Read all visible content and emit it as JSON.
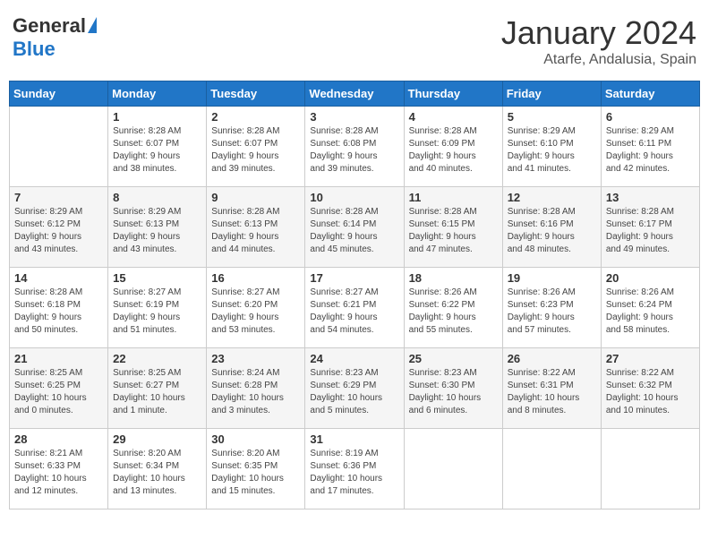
{
  "header": {
    "logo_general": "General",
    "logo_blue": "Blue",
    "month_year": "January 2024",
    "location": "Atarfe, Andalusia, Spain"
  },
  "days_of_week": [
    "Sunday",
    "Monday",
    "Tuesday",
    "Wednesday",
    "Thursday",
    "Friday",
    "Saturday"
  ],
  "weeks": [
    {
      "shaded": false,
      "days": [
        {
          "num": "",
          "info": ""
        },
        {
          "num": "1",
          "info": "Sunrise: 8:28 AM\nSunset: 6:07 PM\nDaylight: 9 hours\nand 38 minutes."
        },
        {
          "num": "2",
          "info": "Sunrise: 8:28 AM\nSunset: 6:07 PM\nDaylight: 9 hours\nand 39 minutes."
        },
        {
          "num": "3",
          "info": "Sunrise: 8:28 AM\nSunset: 6:08 PM\nDaylight: 9 hours\nand 39 minutes."
        },
        {
          "num": "4",
          "info": "Sunrise: 8:28 AM\nSunset: 6:09 PM\nDaylight: 9 hours\nand 40 minutes."
        },
        {
          "num": "5",
          "info": "Sunrise: 8:29 AM\nSunset: 6:10 PM\nDaylight: 9 hours\nand 41 minutes."
        },
        {
          "num": "6",
          "info": "Sunrise: 8:29 AM\nSunset: 6:11 PM\nDaylight: 9 hours\nand 42 minutes."
        }
      ]
    },
    {
      "shaded": true,
      "days": [
        {
          "num": "7",
          "info": "Sunrise: 8:29 AM\nSunset: 6:12 PM\nDaylight: 9 hours\nand 43 minutes."
        },
        {
          "num": "8",
          "info": "Sunrise: 8:29 AM\nSunset: 6:13 PM\nDaylight: 9 hours\nand 43 minutes."
        },
        {
          "num": "9",
          "info": "Sunrise: 8:28 AM\nSunset: 6:13 PM\nDaylight: 9 hours\nand 44 minutes."
        },
        {
          "num": "10",
          "info": "Sunrise: 8:28 AM\nSunset: 6:14 PM\nDaylight: 9 hours\nand 45 minutes."
        },
        {
          "num": "11",
          "info": "Sunrise: 8:28 AM\nSunset: 6:15 PM\nDaylight: 9 hours\nand 47 minutes."
        },
        {
          "num": "12",
          "info": "Sunrise: 8:28 AM\nSunset: 6:16 PM\nDaylight: 9 hours\nand 48 minutes."
        },
        {
          "num": "13",
          "info": "Sunrise: 8:28 AM\nSunset: 6:17 PM\nDaylight: 9 hours\nand 49 minutes."
        }
      ]
    },
    {
      "shaded": false,
      "days": [
        {
          "num": "14",
          "info": "Sunrise: 8:28 AM\nSunset: 6:18 PM\nDaylight: 9 hours\nand 50 minutes."
        },
        {
          "num": "15",
          "info": "Sunrise: 8:27 AM\nSunset: 6:19 PM\nDaylight: 9 hours\nand 51 minutes."
        },
        {
          "num": "16",
          "info": "Sunrise: 8:27 AM\nSunset: 6:20 PM\nDaylight: 9 hours\nand 53 minutes."
        },
        {
          "num": "17",
          "info": "Sunrise: 8:27 AM\nSunset: 6:21 PM\nDaylight: 9 hours\nand 54 minutes."
        },
        {
          "num": "18",
          "info": "Sunrise: 8:26 AM\nSunset: 6:22 PM\nDaylight: 9 hours\nand 55 minutes."
        },
        {
          "num": "19",
          "info": "Sunrise: 8:26 AM\nSunset: 6:23 PM\nDaylight: 9 hours\nand 57 minutes."
        },
        {
          "num": "20",
          "info": "Sunrise: 8:26 AM\nSunset: 6:24 PM\nDaylight: 9 hours\nand 58 minutes."
        }
      ]
    },
    {
      "shaded": true,
      "days": [
        {
          "num": "21",
          "info": "Sunrise: 8:25 AM\nSunset: 6:25 PM\nDaylight: 10 hours\nand 0 minutes."
        },
        {
          "num": "22",
          "info": "Sunrise: 8:25 AM\nSunset: 6:27 PM\nDaylight: 10 hours\nand 1 minute."
        },
        {
          "num": "23",
          "info": "Sunrise: 8:24 AM\nSunset: 6:28 PM\nDaylight: 10 hours\nand 3 minutes."
        },
        {
          "num": "24",
          "info": "Sunrise: 8:23 AM\nSunset: 6:29 PM\nDaylight: 10 hours\nand 5 minutes."
        },
        {
          "num": "25",
          "info": "Sunrise: 8:23 AM\nSunset: 6:30 PM\nDaylight: 10 hours\nand 6 minutes."
        },
        {
          "num": "26",
          "info": "Sunrise: 8:22 AM\nSunset: 6:31 PM\nDaylight: 10 hours\nand 8 minutes."
        },
        {
          "num": "27",
          "info": "Sunrise: 8:22 AM\nSunset: 6:32 PM\nDaylight: 10 hours\nand 10 minutes."
        }
      ]
    },
    {
      "shaded": false,
      "days": [
        {
          "num": "28",
          "info": "Sunrise: 8:21 AM\nSunset: 6:33 PM\nDaylight: 10 hours\nand 12 minutes."
        },
        {
          "num": "29",
          "info": "Sunrise: 8:20 AM\nSunset: 6:34 PM\nDaylight: 10 hours\nand 13 minutes."
        },
        {
          "num": "30",
          "info": "Sunrise: 8:20 AM\nSunset: 6:35 PM\nDaylight: 10 hours\nand 15 minutes."
        },
        {
          "num": "31",
          "info": "Sunrise: 8:19 AM\nSunset: 6:36 PM\nDaylight: 10 hours\nand 17 minutes."
        },
        {
          "num": "",
          "info": ""
        },
        {
          "num": "",
          "info": ""
        },
        {
          "num": "",
          "info": ""
        }
      ]
    }
  ]
}
